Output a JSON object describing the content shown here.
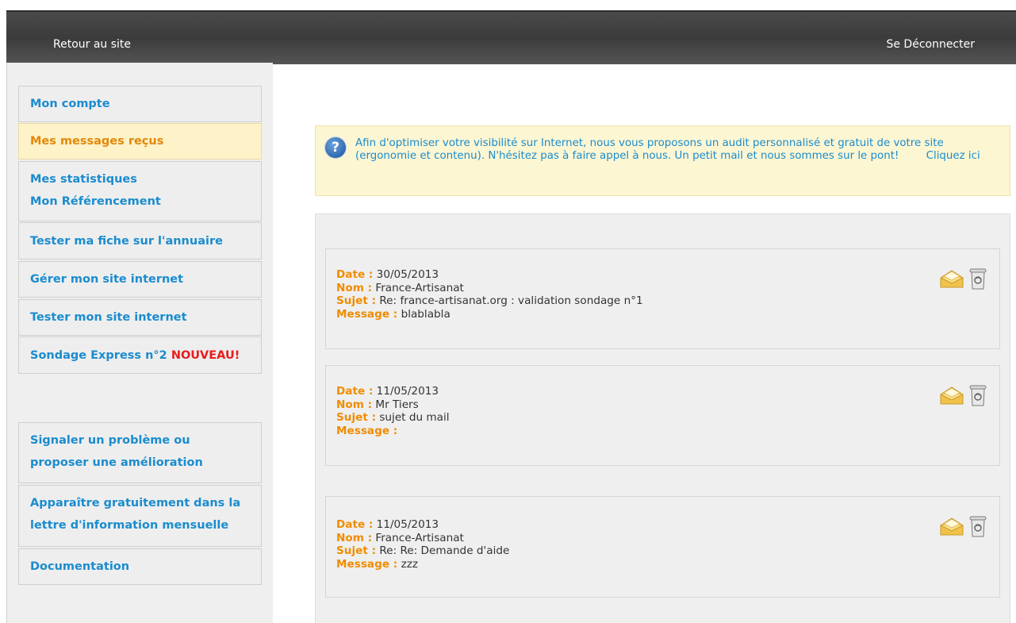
{
  "topbar": {
    "back_label": "Retour au site",
    "logout_label": "Se Déconnecter"
  },
  "sidebar": {
    "items": [
      {
        "label": "Mon compte"
      },
      {
        "label": "Mes messages reçus",
        "active": true
      },
      {
        "label1": "Mes statistiques",
        "label2": "Mon Référencement"
      },
      {
        "label": "Tester ma fiche sur l'annuaire"
      },
      {
        "label": "Gérer mon site internet"
      },
      {
        "label": "Tester mon site internet"
      },
      {
        "label": "Sondage Express n°2",
        "badge": "NOUVEAU!"
      },
      {
        "label1": "Signaler un problème ou",
        "label2": "proposer une amélioration"
      },
      {
        "label1": "Apparaître gratuitement dans la",
        "label2": "lettre d'information mensuelle"
      },
      {
        "label": "Documentation"
      }
    ]
  },
  "info": {
    "text": "Afin d'optimiser votre visibilité sur Internet, nous vous proposons un audit personnalisé et gratuit de votre site (ergonomie et contenu). N'hésitez pas à faire appel à nous. Un petit mail et nous sommes sur le pont!",
    "cta": "Cliquez ici"
  },
  "labels": {
    "date": "Date :",
    "nom": "Nom :",
    "sujet": "Sujet :",
    "message": "Message :"
  },
  "messages": [
    {
      "date": "30/05/2013",
      "nom": "France-Artisanat",
      "sujet": "Re: france-artisanat.org : validation sondage n°1",
      "message": "blablabla"
    },
    {
      "date": "11/05/2013",
      "nom": "Mr Tiers",
      "sujet": "sujet du mail",
      "message": ""
    },
    {
      "date": "11/05/2013",
      "nom": "France-Artisanat",
      "sujet": "Re: Re: Demande d'aide",
      "message": "zzz"
    }
  ],
  "icons": {
    "open": "envelope-open-icon",
    "delete": "trash-icon",
    "help": "question-icon"
  }
}
